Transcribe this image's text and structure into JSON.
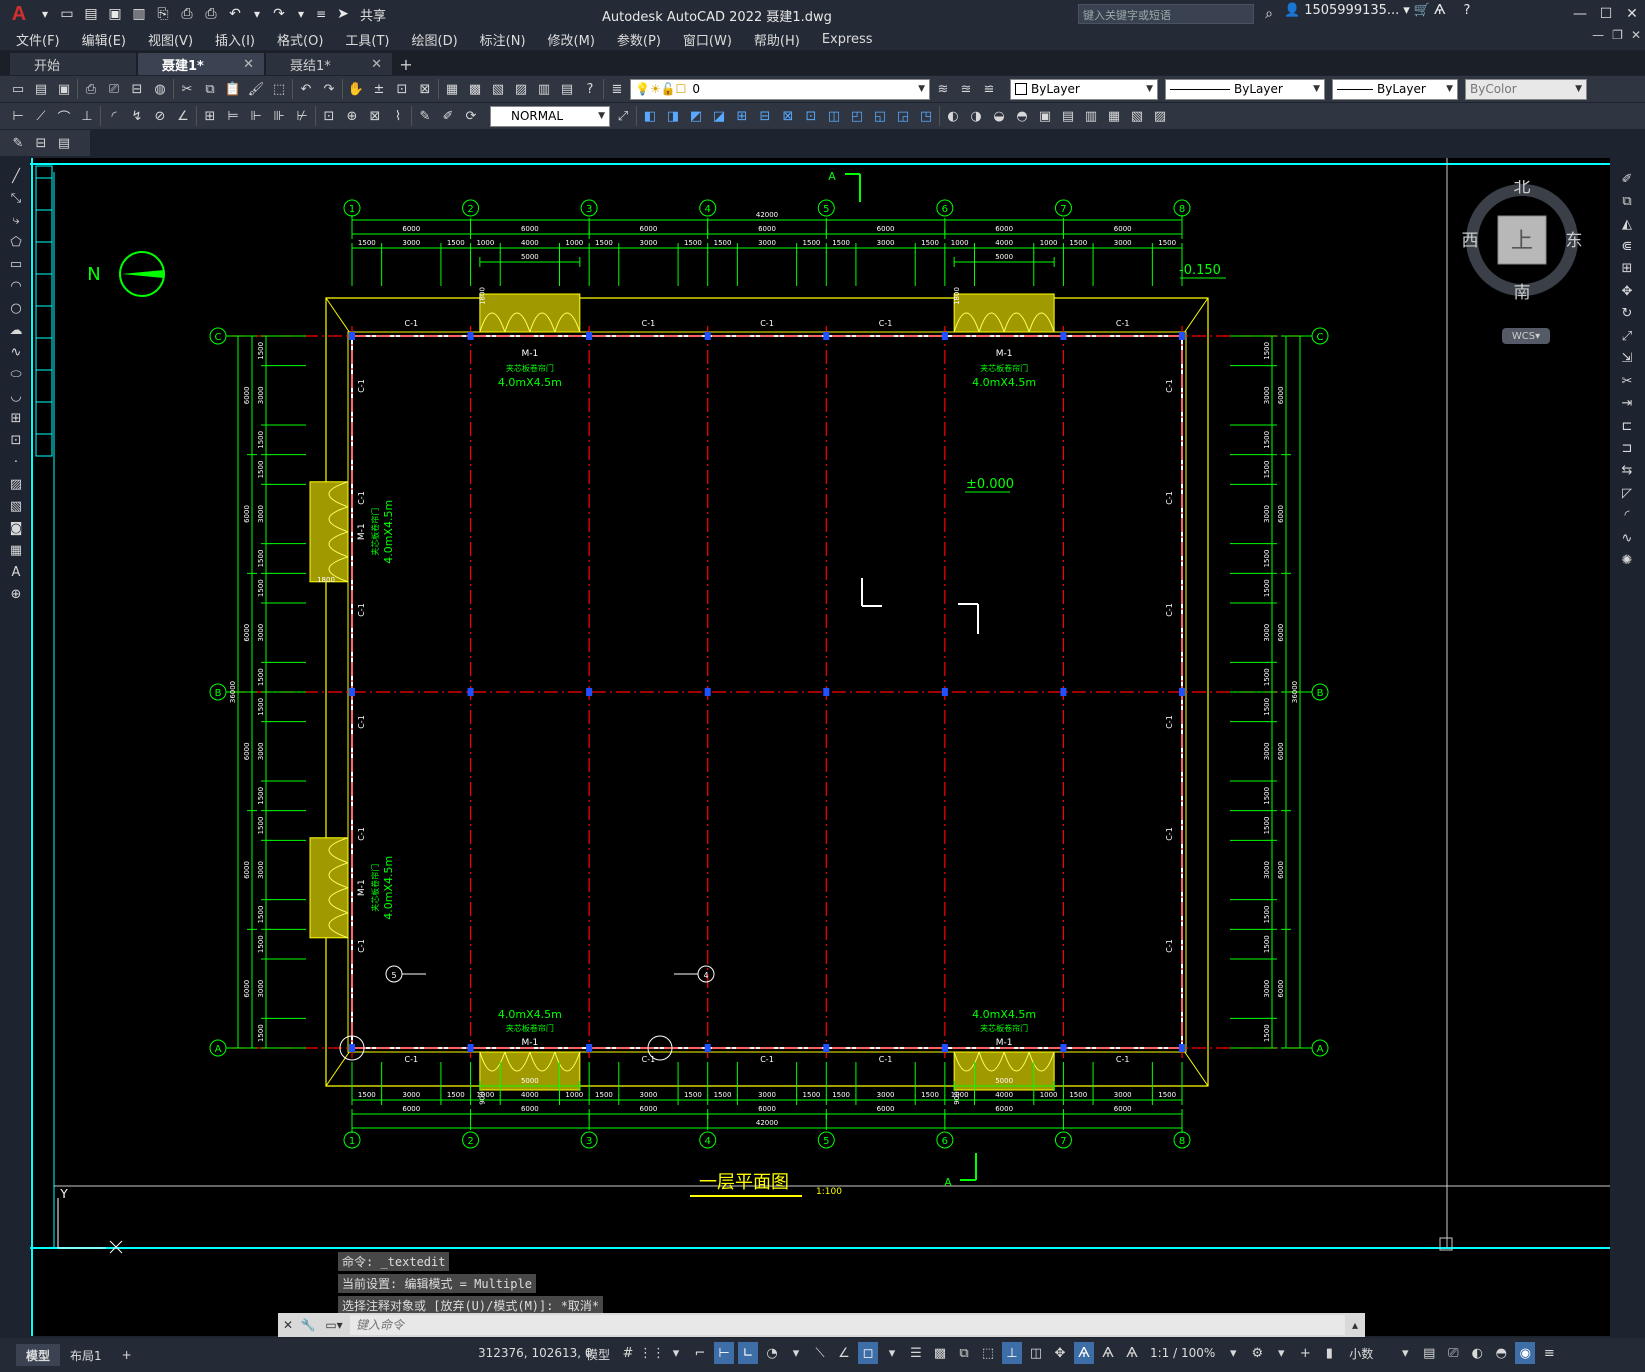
{
  "titlebar": {
    "app_title": "Autodesk AutoCAD 2022    聂建1.dwg",
    "share_label": "共享",
    "search_placeholder": "键入关键字或短语",
    "user": "1505999135...",
    "logo_letter": "A"
  },
  "menu": [
    "文件(F)",
    "编辑(E)",
    "视图(V)",
    "插入(I)",
    "格式(O)",
    "工具(T)",
    "绘图(D)",
    "标注(N)",
    "修改(M)",
    "参数(P)",
    "窗口(W)",
    "帮助(H)",
    "Express"
  ],
  "tabs": [
    {
      "label": "开始",
      "active": false,
      "closable": false
    },
    {
      "label": "聂建1*",
      "active": true,
      "closable": true
    },
    {
      "label": "聂结1*",
      "active": false,
      "closable": true
    }
  ],
  "toolbar": {
    "layer_value": "0",
    "color_value": "ByLayer",
    "linetype_value": "ByLayer",
    "lineweight_value": "ByLayer",
    "plotstyle_value": "ByColor",
    "dimstyle_value": "NORMAL"
  },
  "drawing": {
    "title": "一层平面图",
    "scale": "1:100",
    "level_top": "-0.150",
    "level_mid": "±0.000",
    "total_dim": "42000",
    "side_dim": "36000",
    "grid_x": [
      "1",
      "2",
      "3",
      "4",
      "5",
      "6",
      "7",
      "8"
    ],
    "grid_y": [
      "A",
      "B",
      "C"
    ],
    "bay_dim": "6000",
    "sub_dims": [
      "1500",
      "3000",
      "1500"
    ],
    "door_sub_dims": [
      "1000",
      "4000",
      "1000"
    ],
    "door_span": "5000",
    "door_label": "M-1",
    "door_size": "4.0mX4.5m",
    "door_type": "夹芯板卷帘门",
    "window_label": "C-1",
    "section_label": "A",
    "north_label": "N",
    "sub_900": "900",
    "sub_1800": "1800",
    "detail_marks": [
      "5",
      "4"
    ]
  },
  "viewcube": {
    "north": "北",
    "south": "南",
    "east": "东",
    "west": "西",
    "top": "上",
    "wcs": "WCS"
  },
  "command": {
    "history": [
      "命令: _textedit",
      "当前设置: 编辑模式 = Multiple",
      "选择注释对象或 [放弃(U)/模式(M)]: *取消*"
    ],
    "placeholder": "键入命令"
  },
  "status": {
    "layout_tabs": [
      "模型",
      "布局1"
    ],
    "coords": "312376, 102613, 0",
    "model": "模型",
    "scale": "1:1 / 100%",
    "units": "小数"
  },
  "colors": {
    "bg": "#000000",
    "grid": "#ff0000",
    "dim": "#00ff00",
    "wall": "#ffff00",
    "white": "#ffffff",
    "accent": "#00ffff"
  }
}
